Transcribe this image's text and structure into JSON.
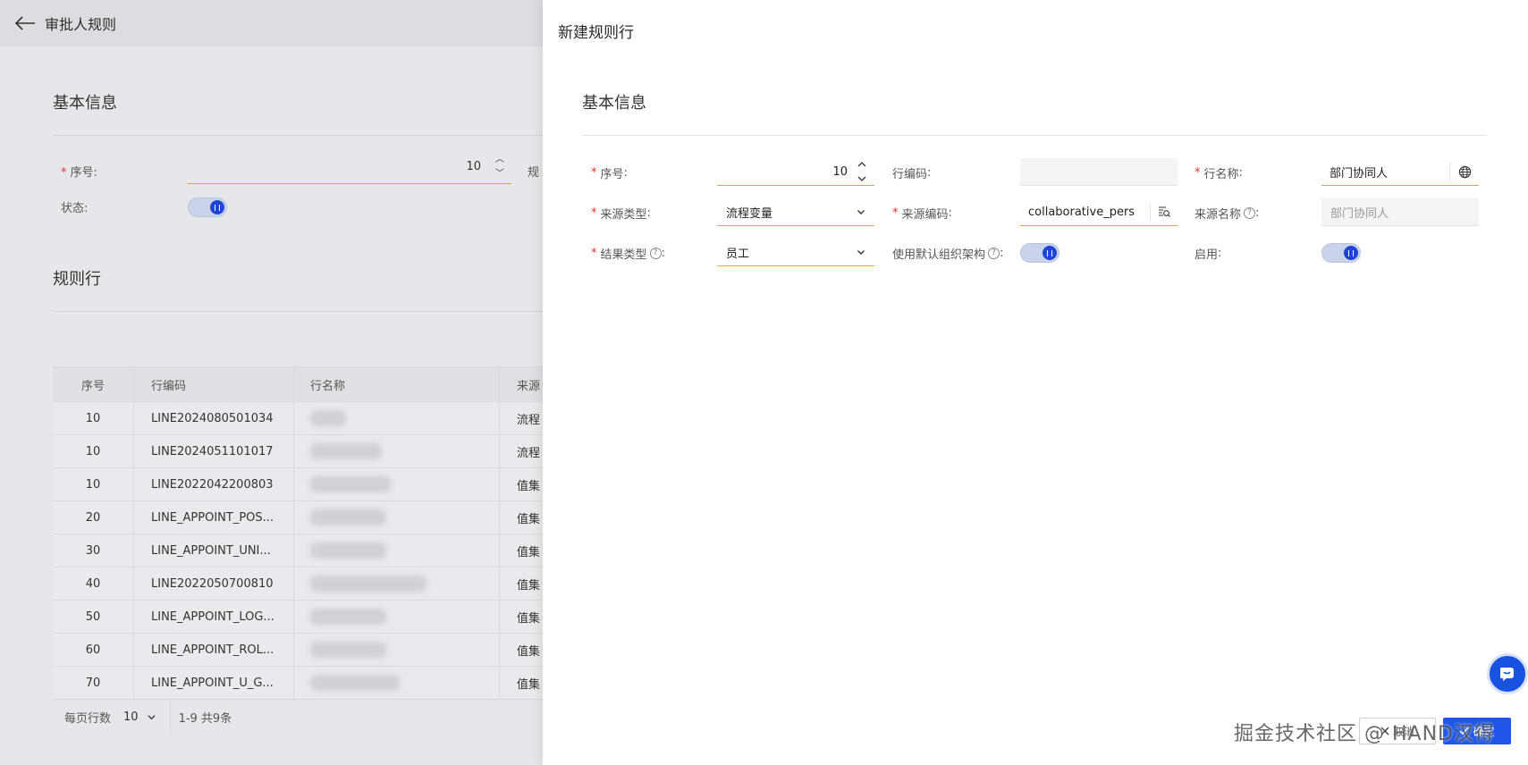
{
  "bg": {
    "header_title": "审批人规则",
    "section_basic": "基本信息",
    "seq_label": "序号",
    "seq_value": "10",
    "clip_label": "规",
    "status_label": "状态",
    "section_rows": "规则行",
    "table": {
      "headers": [
        "序号",
        "行编码",
        "行名称",
        "来源"
      ],
      "rows": [
        {
          "seq": "10",
          "code": "LINE2024080501034",
          "source": "流程"
        },
        {
          "seq": "10",
          "code": "LINE2024051101017",
          "source": "流程"
        },
        {
          "seq": "10",
          "code": "LINE2022042200803",
          "source": "值集"
        },
        {
          "seq": "20",
          "code": "LINE_APPOINT_POS...",
          "source": "值集"
        },
        {
          "seq": "30",
          "code": "LINE_APPOINT_UNI...",
          "source": "值集"
        },
        {
          "seq": "40",
          "code": "LINE2022050700810",
          "source": "值集"
        },
        {
          "seq": "50",
          "code": "LINE_APPOINT_LOG...",
          "source": "值集"
        },
        {
          "seq": "60",
          "code": "LINE_APPOINT_ROL...",
          "source": "值集"
        },
        {
          "seq": "70",
          "code": "LINE_APPOINT_U_G...",
          "source": "值集"
        }
      ]
    },
    "pagination": {
      "per_page_label": "每页行数",
      "per_page_value": "10",
      "range": "1-9 共9条"
    }
  },
  "drawer": {
    "title": "新建规则行",
    "section_basic": "基本信息",
    "fields": {
      "seq": {
        "label": "序号",
        "value": "10"
      },
      "line_code": {
        "label": "行编码",
        "value": ""
      },
      "line_name": {
        "label": "行名称",
        "value": "部门协同人"
      },
      "source_type": {
        "label": "来源类型",
        "value": "流程变量"
      },
      "source_code": {
        "label": "来源编码",
        "value": "collaborative_pers"
      },
      "source_name": {
        "label": "来源名称",
        "value": "部门协同人"
      },
      "result_type": {
        "label": "结果类型",
        "value": "员工"
      },
      "default_org": {
        "label": "使用默认组织架构"
      },
      "enabled": {
        "label": "启用"
      }
    },
    "buttons": {
      "cancel": "取消",
      "ok": "确定"
    }
  },
  "watermark": "掘金技术社区 @ HAND汉得",
  "colors": {
    "primary": "#1e55e6",
    "required": "#e0342f",
    "required_underline": "#d9a93a"
  }
}
